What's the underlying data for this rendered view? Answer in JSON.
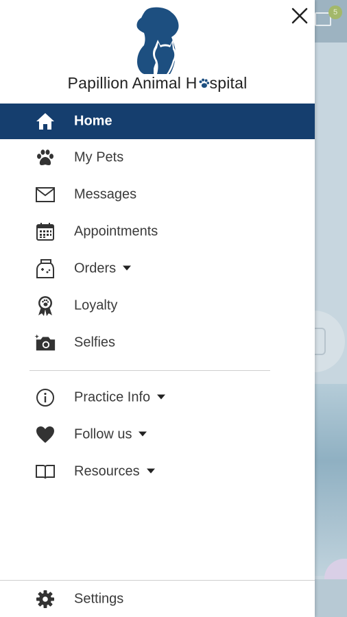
{
  "app": {
    "brand_name_part1": "Papillion Animal H",
    "brand_name_part2": "spital"
  },
  "close_label": "×",
  "menu": {
    "items": [
      {
        "label": "Home",
        "icon": "home-icon",
        "active": true
      },
      {
        "label": "My Pets",
        "icon": "paw-icon"
      },
      {
        "label": "Messages",
        "icon": "envelope-icon"
      },
      {
        "label": "Appointments",
        "icon": "calendar-icon"
      },
      {
        "label": "Orders",
        "icon": "food-bag-icon",
        "dropdown": true
      },
      {
        "label": "Loyalty",
        "icon": "award-ribbon-icon"
      },
      {
        "label": "Selfies",
        "icon": "camera-icon"
      }
    ],
    "secondary": [
      {
        "label": "Practice Info",
        "icon": "info-icon",
        "dropdown": true
      },
      {
        "label": "Follow us",
        "icon": "heart-icon",
        "dropdown": true
      },
      {
        "label": "Resources",
        "icon": "book-icon",
        "dropdown": true
      }
    ],
    "settings": {
      "label": "Settings",
      "icon": "gear-icon"
    }
  },
  "background": {
    "badge_count": "5"
  },
  "colors": {
    "accent": "#153e6e",
    "logo": "#1d4f80",
    "text": "#3a3a3a"
  }
}
